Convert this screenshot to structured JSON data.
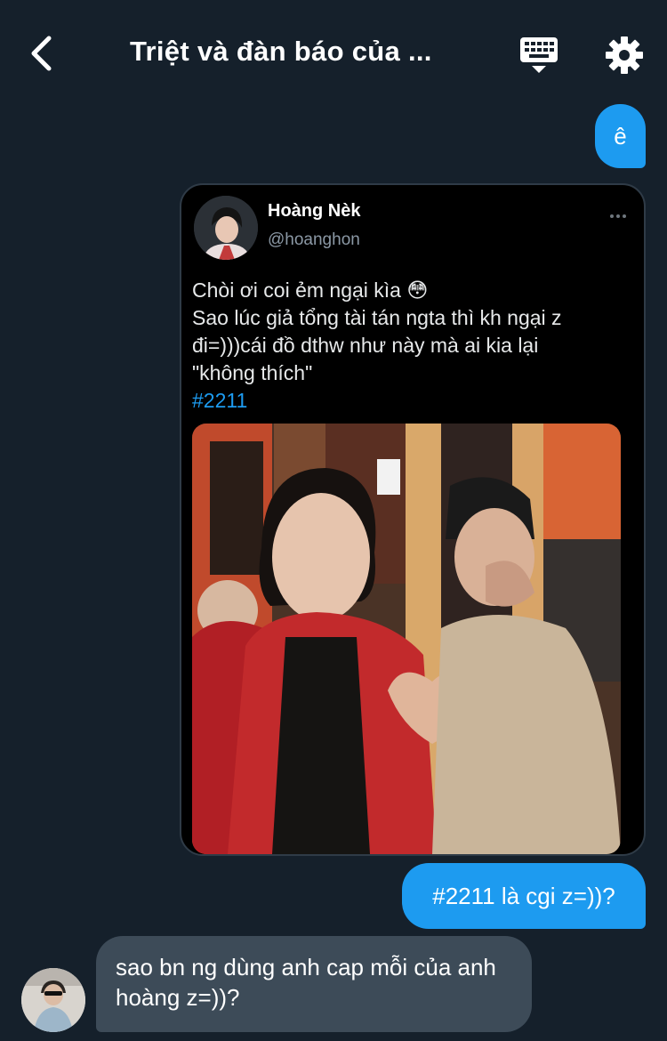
{
  "header": {
    "title": "Triệt và đàn báo của ...",
    "back_icon": "chevron-left-icon",
    "keyboard_icon": "keyboard-icon",
    "settings_icon": "gear-icon"
  },
  "messages": {
    "out_1": "ê",
    "shared_tweet": {
      "author_name": "Hoàng Nèk",
      "author_handle": "@hoanghon",
      "lines": [
        "Chòi ơi coi ẻm ngại kìa 😳",
        "Sao lúc giả tổng tài tán ngta thì kh ngại z",
        "đi=)))cái đồ dthw như này mà ai kia lại",
        "\"không thích\""
      ],
      "hashtag": "#2211"
    },
    "out_2": "#2211 là cgi z=))?",
    "in_1": "sao bn ng dùng anh cap mỗi của anh hoàng z=))?"
  },
  "colors": {
    "background": "#15202b",
    "outgoing_bubble": "#1d9bf0",
    "incoming_bubble": "#3d4b58",
    "hashtag": "#1d9bf0"
  }
}
